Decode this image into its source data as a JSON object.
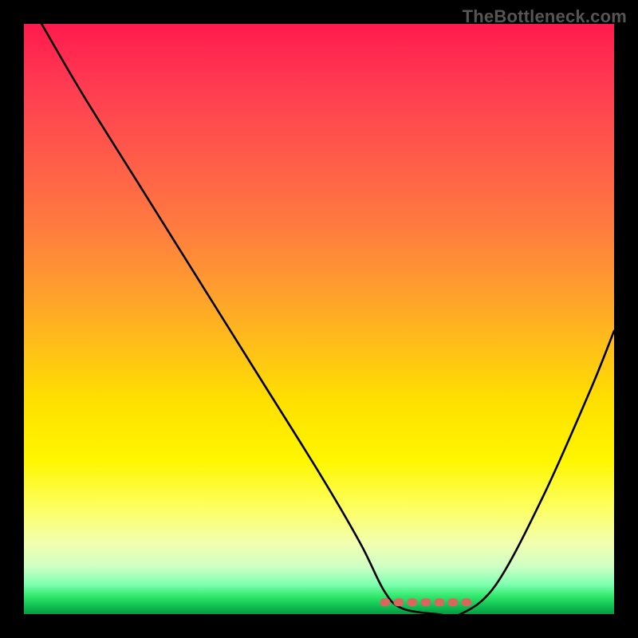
{
  "watermark": "TheBottleneck.com",
  "colors": {
    "background": "#000000",
    "curve": "#000000",
    "flat_marker": "#d8675d"
  },
  "chart_data": {
    "type": "line",
    "title": "",
    "xlabel": "",
    "ylabel": "",
    "xlim": [
      0,
      100
    ],
    "ylim": [
      0,
      100
    ],
    "grid": false,
    "legend": false,
    "series": [
      {
        "name": "bottleneck-curve",
        "x": [
          3,
          10,
          20,
          30,
          40,
          50,
          57,
          61,
          64,
          70,
          74,
          80,
          88,
          96,
          100
        ],
        "y": [
          100,
          88,
          72,
          56,
          40,
          24,
          12,
          4,
          1,
          0,
          0,
          5,
          20,
          38,
          48
        ]
      }
    ],
    "flat_region": {
      "x_start": 61,
      "x_end": 76,
      "y": 2
    },
    "background_gradient": {
      "direction": "vertical",
      "stops": [
        {
          "pos": 0.0,
          "color": "#ff1a4d"
        },
        {
          "pos": 0.44,
          "color": "#ff9a30"
        },
        {
          "pos": 0.74,
          "color": "#fff600"
        },
        {
          "pos": 0.95,
          "color": "#7dffb0"
        },
        {
          "pos": 1.0,
          "color": "#079b3f"
        }
      ]
    }
  }
}
